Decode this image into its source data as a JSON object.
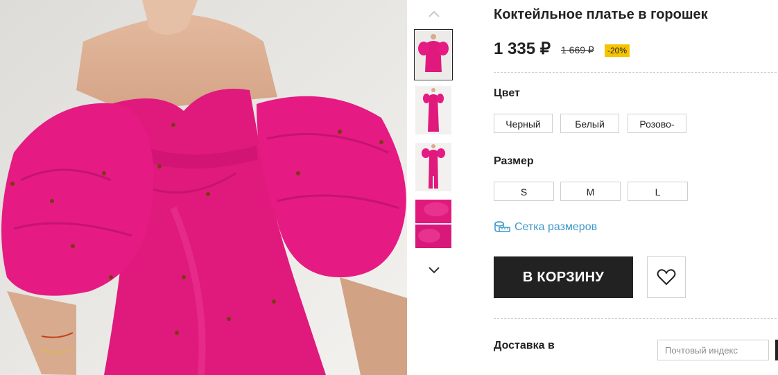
{
  "product": {
    "title": "Коктейльное платье в горошек",
    "price": "1 335 ₽",
    "old_price": "1 669 ₽",
    "discount": "-20%"
  },
  "color_section": {
    "label": "Цвет",
    "options": [
      "Черный",
      "Белый",
      "Розово-"
    ]
  },
  "size_section": {
    "label": "Размер",
    "options": [
      "S",
      "M",
      "L"
    ]
  },
  "size_chart_link": "Сетка размеров",
  "cart_button": "В КОРЗИНУ",
  "delivery": {
    "label": "Доставка в",
    "zip_placeholder": "Почтовый индекс"
  },
  "icons": {
    "thumb_up": "chevron-up-icon",
    "thumb_down": "chevron-down-icon",
    "size_chart": "ruler-icon",
    "favorite": "heart-icon"
  },
  "colors": {
    "accent_link": "#3d98c9",
    "cart_button_bg": "#222222",
    "discount_badge": "#f5c400",
    "dress": "#e0197d"
  }
}
